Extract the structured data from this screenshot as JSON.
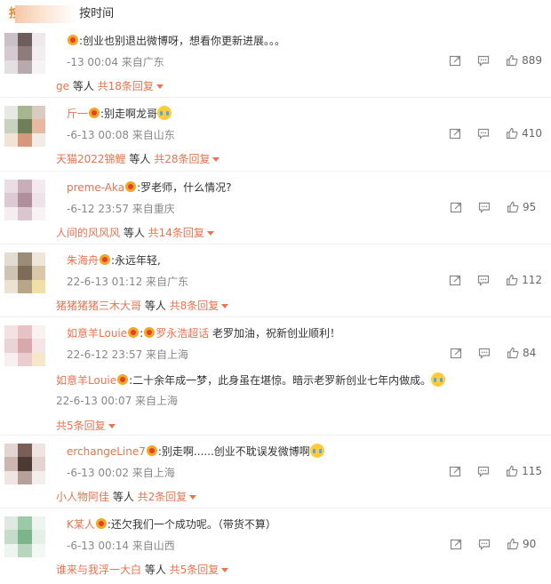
{
  "sort": {
    "hot_label": "按",
    "time_label": "按时间"
  },
  "colors": {
    "nick": "#eb7350",
    "accent": "#e9822c",
    "meta": "#888888"
  },
  "comments": [
    {
      "nick": "",
      "text": ":创业也别退出微博呀，想看你更新进展。。。",
      "meta": "-13 00:04 来自广东",
      "likes": "889",
      "reply_nick": "ge",
      "reply_mid": " 等人 ",
      "reply_count": "共18条回复",
      "avatar": [
        "#c9c1c6",
        "#6d5d5c",
        "#efe9eb",
        "#d6c9cf",
        "#8d7c7b",
        "#f2eef0",
        "#e4dfe2",
        "#b8a9ad",
        "#f5f3f4"
      ]
    },
    {
      "nick": "斤一",
      "text": ":别走啊龙哥",
      "meta": "-6-13 00:08 来自山东",
      "likes": "410",
      "reply_nick": "天猫2022锦鲤",
      "reply_mid": " 等人 ",
      "reply_count": "共28条回复",
      "avatar": [
        "#e6e9e4",
        "#a7b68f",
        "#d9cbbf",
        "#c9d2c0",
        "#6e7f5a",
        "#e8b8a0",
        "#f1e3d6",
        "#d59a7c",
        "#f3ece6"
      ]
    },
    {
      "nick": "preme-Aka",
      "text": ":罗老师，什么情况?",
      "meta": "-6-12 23:57 来自重庆",
      "likes": "95",
      "reply_nick": "人间的风风风",
      "reply_mid": " 等人 ",
      "reply_count": "共14条回复",
      "avatar": [
        "#eadde3",
        "#c7aeb9",
        "#f3e9ee",
        "#dcc9d1",
        "#b08f9d",
        "#efe3e8",
        "#f4eef1",
        "#d9c6ce",
        "#f7f2f4"
      ]
    },
    {
      "nick": "朱海舟",
      "text": ":永远年轻,",
      "meta": "22-6-13 01:12 来自广东",
      "likes": "112",
      "reply_nick": "猪猪猪猪三木大哥",
      "reply_mid": " 等人 ",
      "reply_count": "共8条回复",
      "avatar": [
        "#e3dcd3",
        "#9b8c78",
        "#eee6da",
        "#cfc4b4",
        "#7d6c58",
        "#d9c9a8",
        "#ebe2d4",
        "#b8a688",
        "#f2dfa6"
      ]
    },
    {
      "nick": "如意羊Louie",
      "text": ":",
      "super": "罗永浩超话",
      "text2": " 老罗加油，祝新创业顺利！",
      "meta": "22-6-12 23:57 来自上海",
      "likes": "84",
      "sub_nick": "如意羊Louie",
      "sub_text": ":二十余年成一梦，此身虽在堪惊。暗示老罗新创业七年内做成。",
      "sub_meta": "22-6-13 00:07 来自上海",
      "reply_count": "共5条回复",
      "avatar": [
        "#f3e1e3",
        "#e7c3c6",
        "#faf1f1",
        "#ecd3d6",
        "#d8a8ad",
        "#f6e5e7",
        "#f8eff0",
        "#e9cdd1",
        "#f5e7c8"
      ]
    },
    {
      "nick": "erchangeLine7",
      "text": ":别走啊......创业不耽误发微博啊",
      "meta": "-6-13 00:02 来自上海",
      "likes": "115",
      "reply_nick": "小人物阿佳",
      "reply_mid": " 等人 ",
      "reply_count": "共2条回复",
      "avatar": [
        "#e3d5d2",
        "#7a5f58",
        "#efe4e2",
        "#cdb6b1",
        "#4e3a35",
        "#e4d3cf",
        "#efe6e4",
        "#b8a09a",
        "#f4eeec"
      ]
    },
    {
      "nick": "K某人",
      "text": ":还欠我们一个成功呢。（带货不算）",
      "meta": "-6-13 00:14 来自山西",
      "likes": "90",
      "reply_nick": "谁来与我浮一大白",
      "reply_mid": " 等人 ",
      "reply_count": "共5条回复",
      "avatar": [
        "#dfe9e1",
        "#9cc9a6",
        "#eef4ef",
        "#c6dcca",
        "#7db58a",
        "#e5efe7",
        "#eef5f0",
        "#b7d6bd",
        "#f3f8f4"
      ]
    }
  ]
}
